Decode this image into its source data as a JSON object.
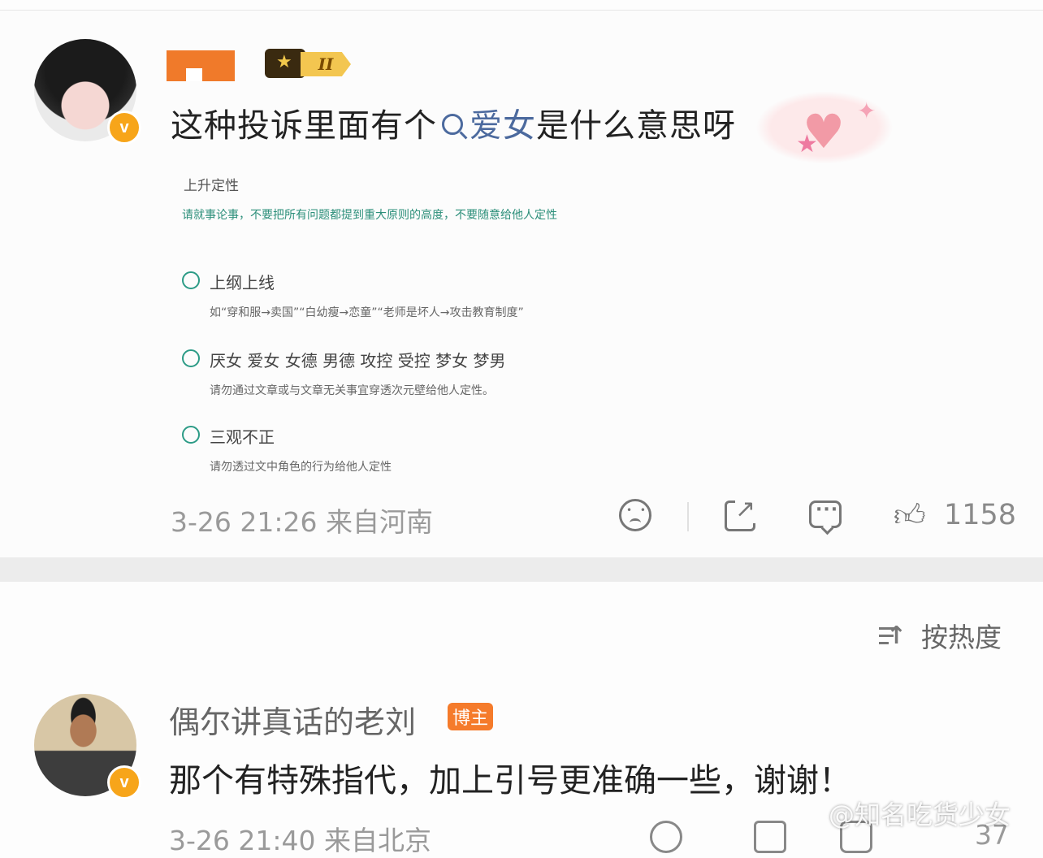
{
  "post": {
    "text_before": "这种投诉里面有个",
    "link_text": "爱女",
    "text_after": "是什么意思呀",
    "vip_rank": "II",
    "avatar_badge": "v",
    "screenshot": {
      "heading": "上升定性",
      "note": "请就事论事，不要把所有问题都提到重大原则的高度，不要随意给他人定性",
      "options": [
        {
          "title": "上纲上线",
          "desc": "如“穿和服→卖国”“白幼瘦→恋童”“老师是坏人→攻击教育制度”"
        },
        {
          "title": "厌女 爱女 女德 男德 攻控 受控 梦女 梦男",
          "desc": "请勿通过文章或与文章无关事宜穿透次元壁给他人定性。"
        },
        {
          "title": "三观不正",
          "desc": "请勿透过文中角色的行为给他人定性"
        }
      ]
    },
    "meta": "3-26 21:26  来自河南",
    "like_count": "1158",
    "icons": [
      "sad-face-icon",
      "share-icon",
      "comment-icon",
      "thumbs-up-icon"
    ]
  },
  "comments": {
    "sort_label": "按热度",
    "items": [
      {
        "name": "偶尔讲真话的老刘",
        "badge": "博主",
        "avatar_badge": "v",
        "text": "那个有特殊指代，加上引号更准确一些，谢谢！",
        "meta": "3-26 21:40  来自北京",
        "likes": "37"
      }
    ]
  },
  "watermark": "@知名吃货少女"
}
